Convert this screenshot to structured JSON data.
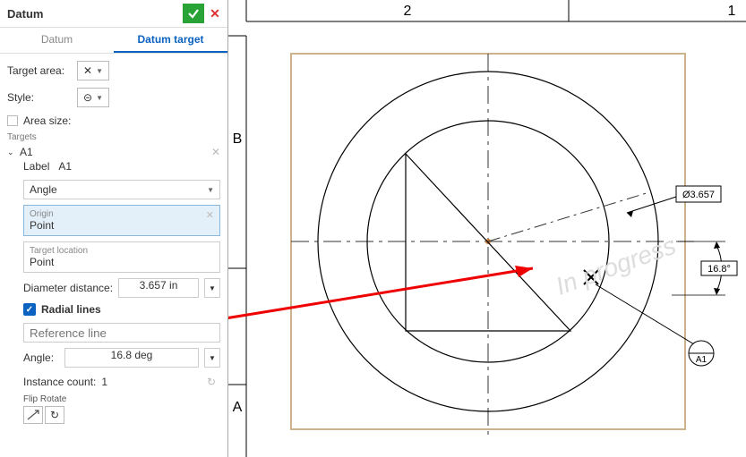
{
  "panel": {
    "title": "Datum",
    "tabs": {
      "datum": "Datum",
      "target": "Datum target",
      "active": "target"
    }
  },
  "form": {
    "target_area_label": "Target area:",
    "target_area_icon": "✕",
    "style_label": "Style:",
    "style_icon": "⊝",
    "area_size_label": "Area size:",
    "targets_label": "Targets",
    "item_name": "A1",
    "label_field_label": "Label",
    "label_field_value": "A1",
    "angle_field_label": "Angle",
    "origin_field_label": "Origin",
    "origin_value": "Point",
    "target_loc_label": "Target location",
    "target_loc_value": "Point",
    "diameter_label": "Diameter distance:",
    "diameter_value": "3.657 in",
    "radial_lines_label": "Radial lines",
    "reference_line_placeholder": "Reference line",
    "angle_label": "Angle:",
    "angle_value": "16.8 deg",
    "instance_label": "Instance count:",
    "instance_value": "1",
    "flip_rotate_label": "Flip  Rotate"
  },
  "drawing": {
    "col_left": "2",
    "col_right": "1",
    "row_top": "B",
    "row_bottom": "A",
    "dim_diameter": "Ø3.657",
    "dim_angle": "16.8°",
    "datum_target_name": "A1",
    "watermark": "In progress"
  },
  "chart_data": {
    "type": "technical-drawing",
    "diameter": 3.657,
    "diameter_unit": "in",
    "angle_deg": 16.8,
    "datum_target": "A1",
    "features": [
      "outer-circle",
      "inner-circle",
      "inscribed-triangle",
      "centerlines",
      "datum-target-symbol"
    ]
  }
}
